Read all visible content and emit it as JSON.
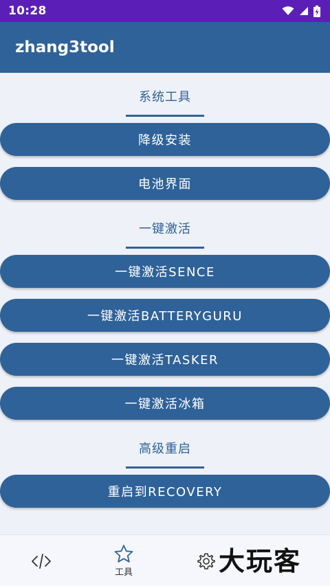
{
  "status_bar": {
    "time": "10:28"
  },
  "app_bar": {
    "title": "zhang3tool"
  },
  "sections": [
    {
      "title": "系统工具",
      "buttons": [
        "降级安装",
        "电池界面"
      ]
    },
    {
      "title": "一键激活",
      "buttons": [
        "一键激活SENCE",
        "一键激活BATTERYGURU",
        "一键激活TASKER",
        "一键激活冰箱"
      ]
    },
    {
      "title": "高级重启",
      "buttons": [
        "重启到RECOVERY"
      ]
    }
  ],
  "bottom_nav": {
    "items": [
      {
        "icon": "code-icon",
        "label": ""
      },
      {
        "icon": "star-icon",
        "label": "工具"
      },
      {
        "icon": "gear-icon",
        "label": ""
      }
    ]
  },
  "watermark": "大玩客",
  "colors": {
    "primary": "#2f6298",
    "status_bar": "#5b1fb8",
    "background": "#eef1f8"
  }
}
